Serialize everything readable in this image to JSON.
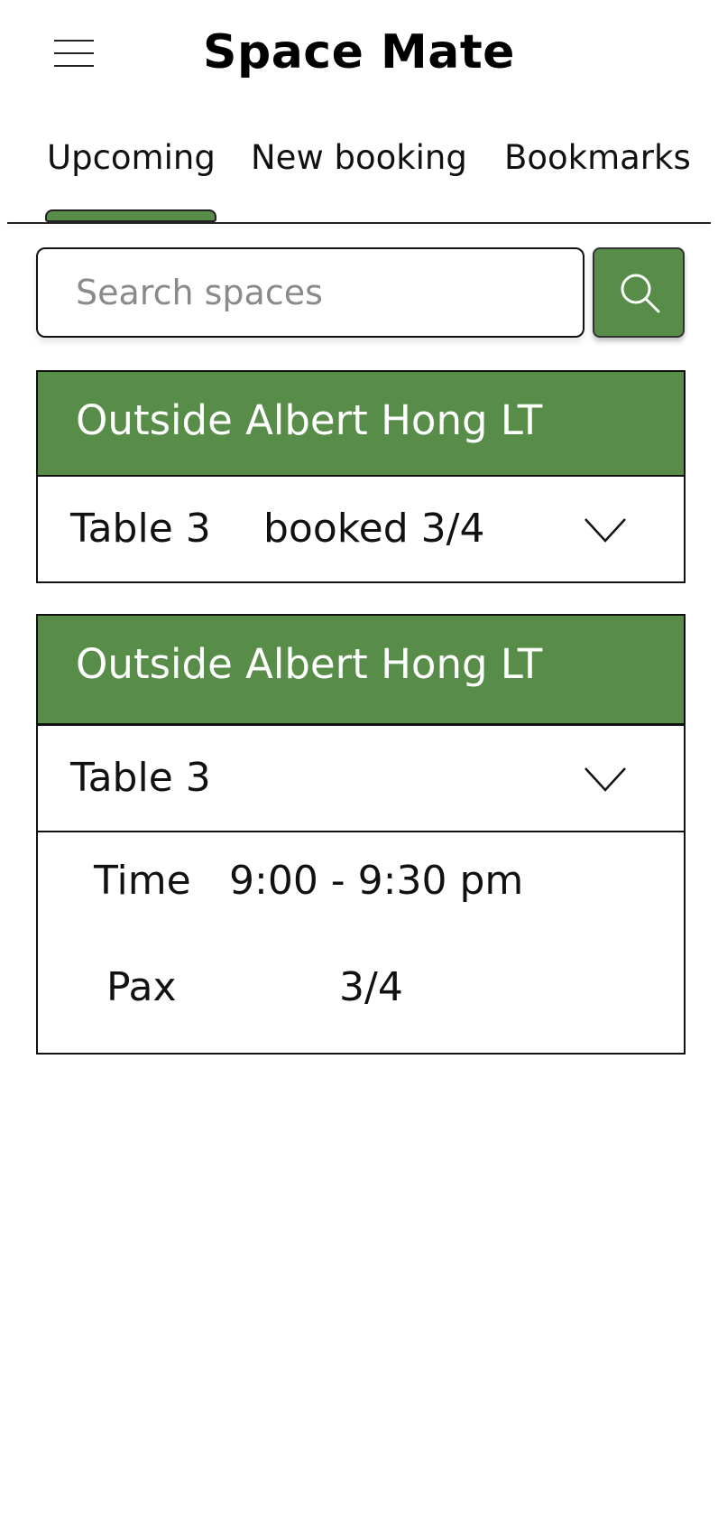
{
  "header": {
    "title": "Space Mate",
    "menu_icon": "hamburger-menu-icon"
  },
  "tabs": [
    {
      "label": "Upcoming",
      "active": true
    },
    {
      "label": "New booking",
      "active": false
    },
    {
      "label": "Bookmarks",
      "active": false
    }
  ],
  "search": {
    "placeholder": "Search spaces",
    "value": "",
    "button_icon": "search-icon"
  },
  "bookings": [
    {
      "location": "Outside Albert Hong LT",
      "table": "Table 3",
      "status": "booked 3/4",
      "expanded": false
    },
    {
      "location": "Outside Albert Hong LT",
      "table": "Table 3",
      "expanded": true,
      "details": {
        "time_label": "Time",
        "time_value": "9:00 - 9:30 pm",
        "pax_label": "Pax",
        "pax_value": "3/4"
      }
    }
  ],
  "colors": {
    "accent": "#588d49",
    "text": "#111111",
    "background": "#ffffff"
  }
}
